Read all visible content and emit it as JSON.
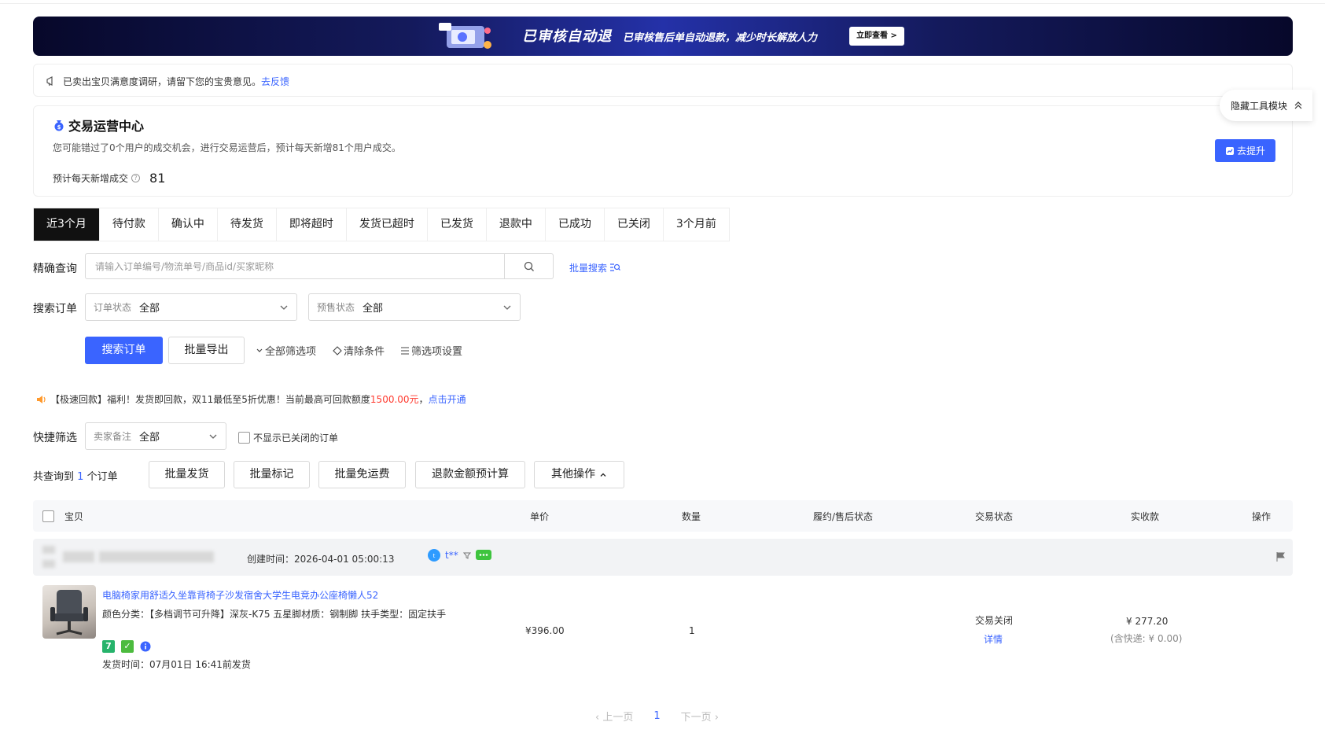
{
  "banner": {
    "title": "已审核自动退",
    "subtitle": "已审核售后单自动退款，减少时长解放人力",
    "button": "立即查看 >"
  },
  "survey": {
    "text": "已卖出宝贝满意度调研，请留下您的宝贵意见。",
    "link": "去反馈"
  },
  "ops_center": {
    "title": "交易运营中心",
    "description": "您可能错过了0个用户的成交机会，进行交易运营后，预计每天新增81个用户成交。",
    "metric_label": "预计每天新增成交",
    "metric_value": "81",
    "button": "去提升"
  },
  "hide_tool": "隐藏工具模块",
  "tabs": [
    "近3个月",
    "待付款",
    "确认中",
    "待发货",
    "即将超时",
    "发货已超时",
    "已发货",
    "退款中",
    "已成功",
    "已关闭",
    "3个月前"
  ],
  "search": {
    "label": "精确查询",
    "placeholder": "请输入订单编号/物流单号/商品id/买家昵称",
    "batch_link": "批量搜索"
  },
  "filters": {
    "label": "搜索订单",
    "order_status_label": "订单状态",
    "order_status_value": "全部",
    "presale_status_label": "预售状态",
    "presale_status_value": "全部"
  },
  "actions": {
    "search_button": "搜索订单",
    "export_button": "批量导出",
    "all_filters": "全部筛选项",
    "clear_filters": "清除条件",
    "filter_settings": "筛选项设置"
  },
  "promo": {
    "prefix": "【极速回款】福利！发货即回款，双11最低至5折优惠！当前最高可回款额度",
    "amount": "1500.00元",
    "sep": "，",
    "link": "点击开通"
  },
  "quick_filter": {
    "label": "快捷筛选",
    "select_label": "卖家备注",
    "select_value": "全部",
    "checkbox_label": "不显示已关闭的订单"
  },
  "results": {
    "prefix": "共查询到",
    "count": "1",
    "suffix": "个订单",
    "buttons": [
      "批量发货",
      "批量标记",
      "批量免运费",
      "退款金额预计算",
      "其他操作"
    ]
  },
  "table": {
    "headers": [
      "宝贝",
      "单价",
      "数量",
      "履约/售后状态",
      "交易状态",
      "实收款",
      "操作"
    ]
  },
  "order": {
    "created_time": "创建时间：2026-04-01 05:00:13",
    "buyer": "t**",
    "product_title": "电脑椅家用舒适久坐靠背椅子沙发宿舍大学生电竞办公座椅懒人52",
    "sku": "颜色分类：【多档调节可升降】深灰-K75  五星脚材质：钢制脚  扶手类型：固定扶手",
    "ship_time": "发货时间：07月01日 16:41前发货",
    "price": "¥396.00",
    "quantity": "1",
    "trade_status": "交易关闭",
    "detail_link": "详情",
    "received": "¥ 277.20",
    "shipping_note": "(含快递: ¥ 0.00)"
  },
  "pager": {
    "prev": "上一页",
    "current": "1",
    "next": "下一页"
  }
}
